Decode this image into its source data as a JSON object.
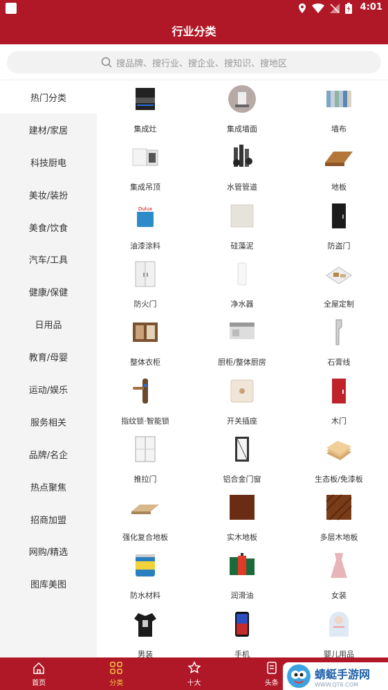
{
  "status_bar": {
    "time": "4:01"
  },
  "header": {
    "title": "行业分类"
  },
  "search": {
    "placeholder": "搜品牌、搜行业、搜企业、搜知识、搜地区"
  },
  "sidebar": {
    "items": [
      {
        "label": "热门分类",
        "active": true
      },
      {
        "label": "建材/家居"
      },
      {
        "label": "科技厨电"
      },
      {
        "label": "美妆/装扮"
      },
      {
        "label": "美食/饮食"
      },
      {
        "label": "汽车/工具"
      },
      {
        "label": "健康/保健"
      },
      {
        "label": "日用品"
      },
      {
        "label": "教育/母婴"
      },
      {
        "label": "运动/娱乐"
      },
      {
        "label": "服务相关"
      },
      {
        "label": "品牌/名企"
      },
      {
        "label": "热点聚焦"
      },
      {
        "label": "招商加盟"
      },
      {
        "label": "网购/精选"
      },
      {
        "label": "图库美图"
      }
    ]
  },
  "categories": [
    {
      "label": "集成灶",
      "icon": "stove-icon"
    },
    {
      "label": "集成墙面",
      "icon": "wall-panel-icon"
    },
    {
      "label": "墙布",
      "icon": "wall-cloth-icon"
    },
    {
      "label": "集成吊顶",
      "icon": "ceiling-icon"
    },
    {
      "label": "水管管道",
      "icon": "pipe-icon"
    },
    {
      "label": "地板",
      "icon": "floor-board-icon"
    },
    {
      "label": "油漆涂料",
      "icon": "paint-bucket-icon"
    },
    {
      "label": "硅藻泥",
      "icon": "diatom-mud-icon"
    },
    {
      "label": "防盗门",
      "icon": "security-door-icon"
    },
    {
      "label": "防火门",
      "icon": "fire-door-icon"
    },
    {
      "label": "净水器",
      "icon": "water-purifier-icon"
    },
    {
      "label": "全屋定制",
      "icon": "whole-house-icon"
    },
    {
      "label": "整体衣柜",
      "icon": "wardrobe-icon"
    },
    {
      "label": "厨柜/整体厨房",
      "icon": "kitchen-icon"
    },
    {
      "label": "石膏线",
      "icon": "plaster-line-icon"
    },
    {
      "label": "指纹锁·智能锁",
      "icon": "smart-lock-icon"
    },
    {
      "label": "开关插座",
      "icon": "switch-socket-icon"
    },
    {
      "label": "木门",
      "icon": "wood-door-icon"
    },
    {
      "label": "推拉门",
      "icon": "sliding-door-icon"
    },
    {
      "label": "铝合金门窗",
      "icon": "aluminum-window-icon"
    },
    {
      "label": "生态板/免漆板",
      "icon": "eco-board-icon"
    },
    {
      "label": "强化复合地板",
      "icon": "laminate-floor-icon"
    },
    {
      "label": "实木地板",
      "icon": "solid-wood-floor-icon"
    },
    {
      "label": "多层木地板",
      "icon": "multilayer-floor-icon"
    },
    {
      "label": "防水材料",
      "icon": "waterproof-can-icon"
    },
    {
      "label": "润滑油",
      "icon": "lubricant-icon"
    },
    {
      "label": "女装",
      "icon": "dress-icon"
    },
    {
      "label": "男装",
      "icon": "mens-shirt-icon"
    },
    {
      "label": "手机",
      "icon": "phone-icon"
    },
    {
      "label": "婴儿用品",
      "icon": "baby-swaddle-icon"
    }
  ],
  "tabbar": {
    "items": [
      {
        "label": "首页",
        "icon": "home-icon"
      },
      {
        "label": "分类",
        "icon": "category-icon",
        "active": true
      },
      {
        "label": "十大",
        "icon": "star-icon"
      },
      {
        "label": "头条",
        "icon": "news-icon"
      },
      {
        "label": ""
      }
    ]
  },
  "watermark": {
    "name": "蜻蜓手游网",
    "url": "WWW.QT6.COM"
  },
  "colors": {
    "brand": "#b01827",
    "active_tab": "#f7c544",
    "sidebar_bg": "#f4f4f4"
  }
}
